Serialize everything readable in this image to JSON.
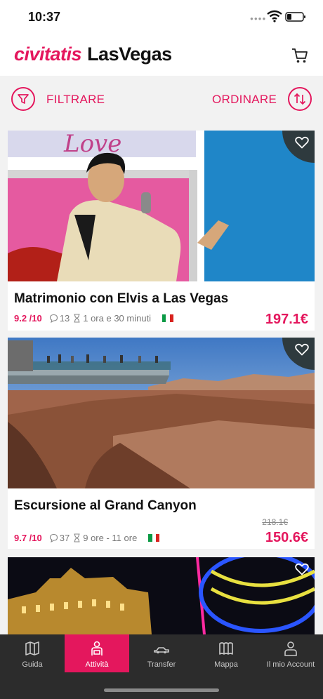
{
  "status_bar": {
    "time": "10:37"
  },
  "header": {
    "brand": "civitatis",
    "city": "LasVegas"
  },
  "filters": {
    "filter_label": "FILTRARE",
    "order_label": "ORDINARE"
  },
  "activities": [
    {
      "title": "Matrimonio con Elvis a Las Vegas",
      "rating": "9.2 /10",
      "reviews": "13",
      "duration": "1 ora e 30 minuti",
      "price": "197.1€",
      "image_text": "Love"
    },
    {
      "title": "Escursione al Grand Canyon",
      "rating": "9.7 /10",
      "reviews": "37",
      "duration": "9 ore - 11 ore",
      "old_price": "218.1€",
      "price": "150.6€"
    }
  ],
  "nav": {
    "items": [
      {
        "label": "Guida",
        "icon": "map-book-icon"
      },
      {
        "label": "Attività",
        "icon": "tourist-icon"
      },
      {
        "label": "Transfer",
        "icon": "car-icon"
      },
      {
        "label": "Mappa",
        "icon": "map-icon"
      },
      {
        "label": "Il mio Account",
        "icon": "user-icon"
      }
    ]
  },
  "colors": {
    "brand": "#e4175d",
    "nav_bg": "#2c2c2c",
    "fav_bg": "#2e3a3e"
  }
}
